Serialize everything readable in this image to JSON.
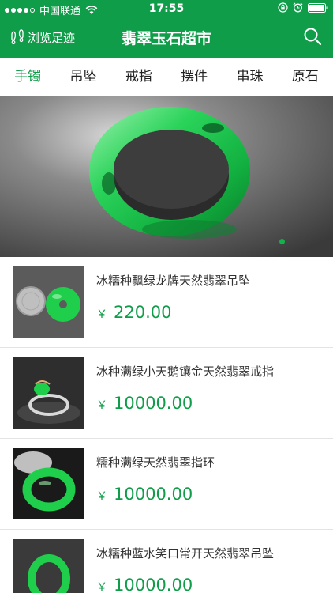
{
  "status_bar": {
    "carrier": "中国联通",
    "time": "17:55"
  },
  "nav": {
    "history_label": "浏览足迹",
    "title": "翡翠玉石超市"
  },
  "tabs": [
    {
      "label": "手镯"
    },
    {
      "label": "吊坠"
    },
    {
      "label": "戒指"
    },
    {
      "label": "摆件"
    },
    {
      "label": "串珠"
    },
    {
      "label": "原石"
    }
  ],
  "active_tab": "手镯",
  "banner": {
    "page_count": 2,
    "active_page": 1
  },
  "products": [
    {
      "title": "冰糯种飘绿龙牌天然翡翠吊坠",
      "currency": "￥",
      "price": "220.00"
    },
    {
      "title": "冰种满绿小天鹅镶金天然翡翠戒指",
      "currency": "￥",
      "price": "10000.00"
    },
    {
      "title": "糯种满绿天然翡翠指环",
      "currency": "￥",
      "price": "10000.00"
    },
    {
      "title": "冰糯种蓝水笑口常开天然翡翠吊坠",
      "currency": "￥",
      "price": "10000.00"
    }
  ],
  "colors": {
    "brand_green": "#0f9d49",
    "jade_green": "#1fcf4c"
  },
  "icons": {
    "history": "footprint-icon",
    "search": "search-icon",
    "wifi": "wifi-icon",
    "lock": "rotation-lock-icon",
    "alarm": "alarm-icon",
    "battery": "battery-icon"
  }
}
